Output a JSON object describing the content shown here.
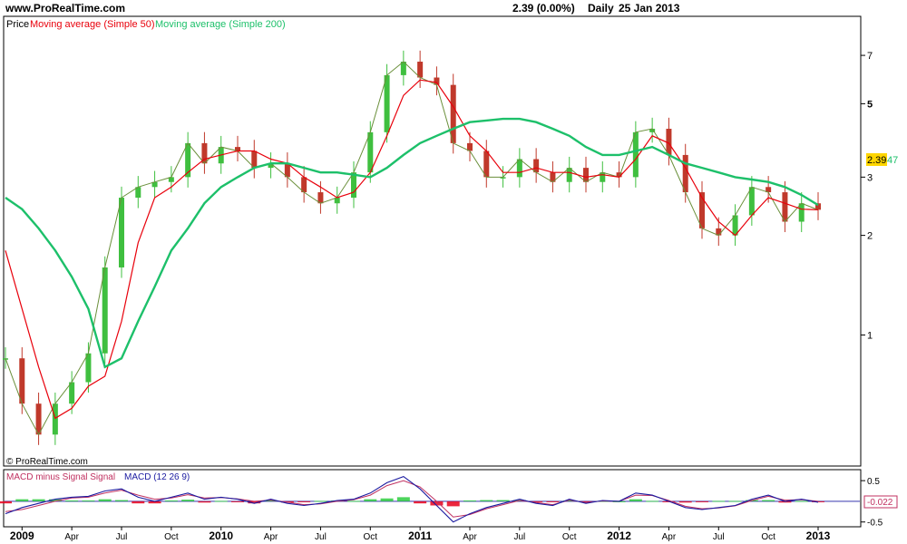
{
  "header": {
    "site": "www.ProRealTime.com",
    "quote": "2.39 (0.00%)",
    "period": "Daily",
    "date": "25 Jan 2013"
  },
  "chart_data": [
    {
      "type": "line",
      "panel": "price",
      "scale": "log",
      "ylim": [
        0.45,
        8.2
      ],
      "legend": [
        "Price",
        "Moving average (Simple 50)",
        "Moving average (Simple 200)"
      ],
      "y_ticks": [
        "7",
        "5",
        "3",
        "2",
        "1"
      ],
      "y_tick_values": [
        7,
        5,
        3,
        2,
        1
      ],
      "last_price_label": "2.39",
      "last_ma_label": "47",
      "copyright": "© ProRealTime.com",
      "colors": {
        "ma50": "#e8000b",
        "ma200": "#1dc06a",
        "up": "#3fbf3f",
        "down": "#c0392b"
      },
      "x": [
        "2008-12",
        "2009-01",
        "2009-02",
        "2009-03",
        "2009-04",
        "2009-05",
        "2009-06",
        "2009-07",
        "2009-08",
        "2009-09",
        "2009-10",
        "2009-11",
        "2009-12",
        "2010-01",
        "2010-02",
        "2010-03",
        "2010-04",
        "2010-05",
        "2010-06",
        "2010-07",
        "2010-08",
        "2010-09",
        "2010-10",
        "2010-11",
        "2010-12",
        "2011-01",
        "2011-02",
        "2011-03",
        "2011-04",
        "2011-05",
        "2011-06",
        "2011-07",
        "2011-08",
        "2011-09",
        "2011-10",
        "2011-11",
        "2011-12",
        "2012-01",
        "2012-02",
        "2012-03",
        "2012-04",
        "2012-05",
        "2012-06",
        "2012-07",
        "2012-08",
        "2012-09",
        "2012-10",
        "2012-11",
        "2012-12",
        "2013-01"
      ],
      "series": [
        {
          "name": "Price",
          "values": [
            0.85,
            0.62,
            0.5,
            0.62,
            0.72,
            0.88,
            1.6,
            2.6,
            2.8,
            2.9,
            3.0,
            3.8,
            3.3,
            3.7,
            3.6,
            3.2,
            3.3,
            3.0,
            2.7,
            2.5,
            2.6,
            3.1,
            4.1,
            6.1,
            6.7,
            6.0,
            5.7,
            3.8,
            3.6,
            3.0,
            3.0,
            3.4,
            3.1,
            2.9,
            3.2,
            2.9,
            3.1,
            3.0,
            4.1,
            4.2,
            3.5,
            2.7,
            2.1,
            2.0,
            2.3,
            2.8,
            2.7,
            2.2,
            2.5,
            2.39
          ]
        },
        {
          "name": "Moving average (Simple 50)",
          "values": [
            1.8,
            1.2,
            0.8,
            0.56,
            0.6,
            0.7,
            0.75,
            1.1,
            1.9,
            2.6,
            2.8,
            3.1,
            3.4,
            3.5,
            3.6,
            3.6,
            3.4,
            3.3,
            3.0,
            2.8,
            2.6,
            2.7,
            3.1,
            4.0,
            5.3,
            5.9,
            5.8,
            4.9,
            4.0,
            3.6,
            3.1,
            3.1,
            3.2,
            3.1,
            3.1,
            3.0,
            3.05,
            3.0,
            3.4,
            4.0,
            3.8,
            3.2,
            2.6,
            2.2,
            2.0,
            2.3,
            2.6,
            2.5,
            2.4,
            2.39
          ]
        },
        {
          "name": "Moving average (Simple 200)",
          "values": [
            2.6,
            2.4,
            2.1,
            1.8,
            1.5,
            1.2,
            0.8,
            0.85,
            1.1,
            1.4,
            1.8,
            2.1,
            2.5,
            2.8,
            3.0,
            3.2,
            3.3,
            3.3,
            3.2,
            3.1,
            3.1,
            3.05,
            3.0,
            3.2,
            3.5,
            3.8,
            4.0,
            4.2,
            4.4,
            4.45,
            4.5,
            4.5,
            4.4,
            4.2,
            4.0,
            3.7,
            3.5,
            3.5,
            3.6,
            3.7,
            3.5,
            3.3,
            3.2,
            3.1,
            3.0,
            2.95,
            2.9,
            2.8,
            2.65,
            2.47
          ]
        }
      ]
    },
    {
      "type": "line",
      "panel": "macd",
      "legend_a": "MACD minus Signal Signal",
      "legend_b": "MACD (12 26 9)",
      "ylim": [
        -0.55,
        0.7
      ],
      "y_ticks": [
        "0.5",
        "-0.5"
      ],
      "y_tick_values": [
        0.5,
        -0.5
      ],
      "last_label": "-0.022",
      "colors": {
        "macd": "#1a1aa0",
        "signal": "#c03060",
        "hist_up": "#2ecc40",
        "hist_down": "#e8001c"
      },
      "x": [
        "2008-12",
        "2009-01",
        "2009-02",
        "2009-03",
        "2009-04",
        "2009-05",
        "2009-06",
        "2009-07",
        "2009-08",
        "2009-09",
        "2009-10",
        "2009-11",
        "2009-12",
        "2010-01",
        "2010-02",
        "2010-03",
        "2010-04",
        "2010-05",
        "2010-06",
        "2010-07",
        "2010-08",
        "2010-09",
        "2010-10",
        "2010-11",
        "2010-12",
        "2011-01",
        "2011-02",
        "2011-03",
        "2011-04",
        "2011-05",
        "2011-06",
        "2011-07",
        "2011-08",
        "2011-09",
        "2011-10",
        "2011-11",
        "2011-12",
        "2012-01",
        "2012-02",
        "2012-03",
        "2012-04",
        "2012-05",
        "2012-06",
        "2012-07",
        "2012-08",
        "2012-09",
        "2012-10",
        "2012-11",
        "2012-12",
        "2013-01"
      ],
      "series": [
        {
          "name": "MACD",
          "values": [
            -0.3,
            -0.15,
            -0.05,
            0.05,
            0.1,
            0.12,
            0.25,
            0.3,
            0.1,
            0.0,
            0.1,
            0.2,
            0.05,
            0.1,
            0.05,
            -0.05,
            0.05,
            -0.05,
            -0.1,
            -0.05,
            0.02,
            0.05,
            0.2,
            0.45,
            0.6,
            0.3,
            -0.1,
            -0.5,
            -0.3,
            -0.15,
            -0.05,
            0.05,
            -0.05,
            -0.1,
            0.05,
            -0.05,
            0.02,
            0.0,
            0.2,
            0.15,
            0.0,
            -0.15,
            -0.2,
            -0.15,
            -0.1,
            0.05,
            0.15,
            0.0,
            0.05,
            -0.022
          ]
        },
        {
          "name": "Signal",
          "values": [
            -0.25,
            -0.2,
            -0.1,
            0.0,
            0.08,
            0.1,
            0.2,
            0.27,
            0.15,
            0.05,
            0.08,
            0.16,
            0.08,
            0.09,
            0.06,
            0.0,
            0.03,
            -0.02,
            -0.08,
            -0.06,
            0.0,
            0.04,
            0.15,
            0.38,
            0.5,
            0.35,
            0.0,
            -0.38,
            -0.32,
            -0.18,
            -0.08,
            0.02,
            -0.03,
            -0.08,
            0.03,
            -0.03,
            0.01,
            0.0,
            0.15,
            0.14,
            0.02,
            -0.12,
            -0.18,
            -0.16,
            -0.11,
            0.02,
            0.12,
            0.03,
            0.04,
            0.0
          ]
        }
      ],
      "histogram": [
        -0.05,
        0.05,
        0.05,
        0.05,
        0.02,
        0.02,
        0.05,
        0.03,
        -0.05,
        -0.05,
        0.02,
        0.04,
        -0.03,
        0.01,
        -0.01,
        -0.05,
        0.02,
        -0.03,
        -0.02,
        0.01,
        0.02,
        0.01,
        0.05,
        0.07,
        0.1,
        -0.05,
        -0.1,
        -0.12,
        0.02,
        0.03,
        0.03,
        0.03,
        -0.02,
        -0.02,
        0.02,
        -0.02,
        0.01,
        0.0,
        0.05,
        0.01,
        -0.02,
        -0.03,
        -0.02,
        0.01,
        0.01,
        0.03,
        0.03,
        -0.03,
        0.01,
        -0.022
      ]
    }
  ],
  "x_axis": {
    "labels": [
      {
        "text": "2009",
        "month": 1,
        "bold": true
      },
      {
        "text": "Apr",
        "month": 4
      },
      {
        "text": "Jul",
        "month": 7
      },
      {
        "text": "Oct",
        "month": 10
      },
      {
        "text": "2010",
        "month": 13,
        "bold": true
      },
      {
        "text": "Apr",
        "month": 16
      },
      {
        "text": "Jul",
        "month": 19
      },
      {
        "text": "Oct",
        "month": 22
      },
      {
        "text": "2011",
        "month": 25,
        "bold": true
      },
      {
        "text": "Apr",
        "month": 28
      },
      {
        "text": "Jul",
        "month": 31
      },
      {
        "text": "Oct",
        "month": 34
      },
      {
        "text": "2012",
        "month": 37,
        "bold": true
      },
      {
        "text": "Apr",
        "month": 40
      },
      {
        "text": "Jul",
        "month": 43
      },
      {
        "text": "Oct",
        "month": 46
      },
      {
        "text": "2013",
        "month": 49,
        "bold": true
      }
    ]
  }
}
